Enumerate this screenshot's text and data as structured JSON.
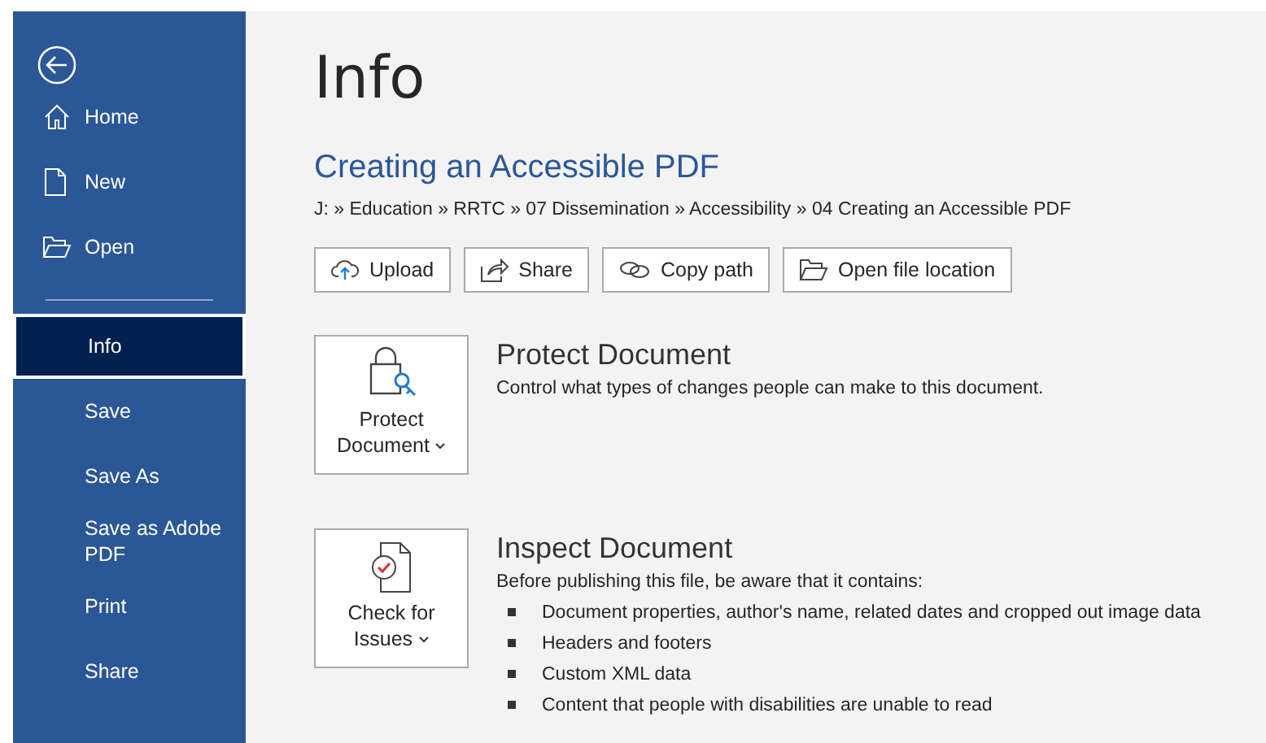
{
  "nav_top": [
    {
      "label": "Home",
      "kind": "home",
      "selected": false
    },
    {
      "label": "New",
      "kind": "new",
      "selected": false
    },
    {
      "label": "Open",
      "kind": "open",
      "selected": false
    }
  ],
  "nav": [
    {
      "label": "Info",
      "selected": true
    },
    {
      "label": "Save",
      "selected": false
    },
    {
      "label": "Save As",
      "selected": false
    },
    {
      "label": "Save as Adobe PDF",
      "selected": false
    },
    {
      "label": "Print",
      "selected": false
    },
    {
      "label": "Share",
      "selected": false
    }
  ],
  "page_title": "Info",
  "document": {
    "title": "Creating an Accessible PDF",
    "path": "J: » Education » RRTC » 07 Dissemination » Accessibility » 04 Creating an Accessible PDF"
  },
  "actions": [
    {
      "label": "Upload",
      "kind": "upload"
    },
    {
      "label": "Share",
      "kind": "share"
    },
    {
      "label": "Copy path",
      "kind": "link"
    },
    {
      "label": "Open file location",
      "kind": "folder"
    }
  ],
  "sections": [
    {
      "kind": "protect",
      "button": [
        "Protect",
        "Document"
      ],
      "title": "Protect Document",
      "description": "Control what types of changes people can make to this document."
    },
    {
      "kind": "inspect",
      "button": [
        "Check for",
        "Issues"
      ],
      "title": "Inspect Document",
      "description": "Before publishing this file, be aware that it contains:",
      "bullets": [
        "Document properties, author's name, related dates and cropped out image data",
        "Headers and footers",
        "Custom XML data",
        "Content that people with disabilities are unable to read"
      ]
    }
  ]
}
